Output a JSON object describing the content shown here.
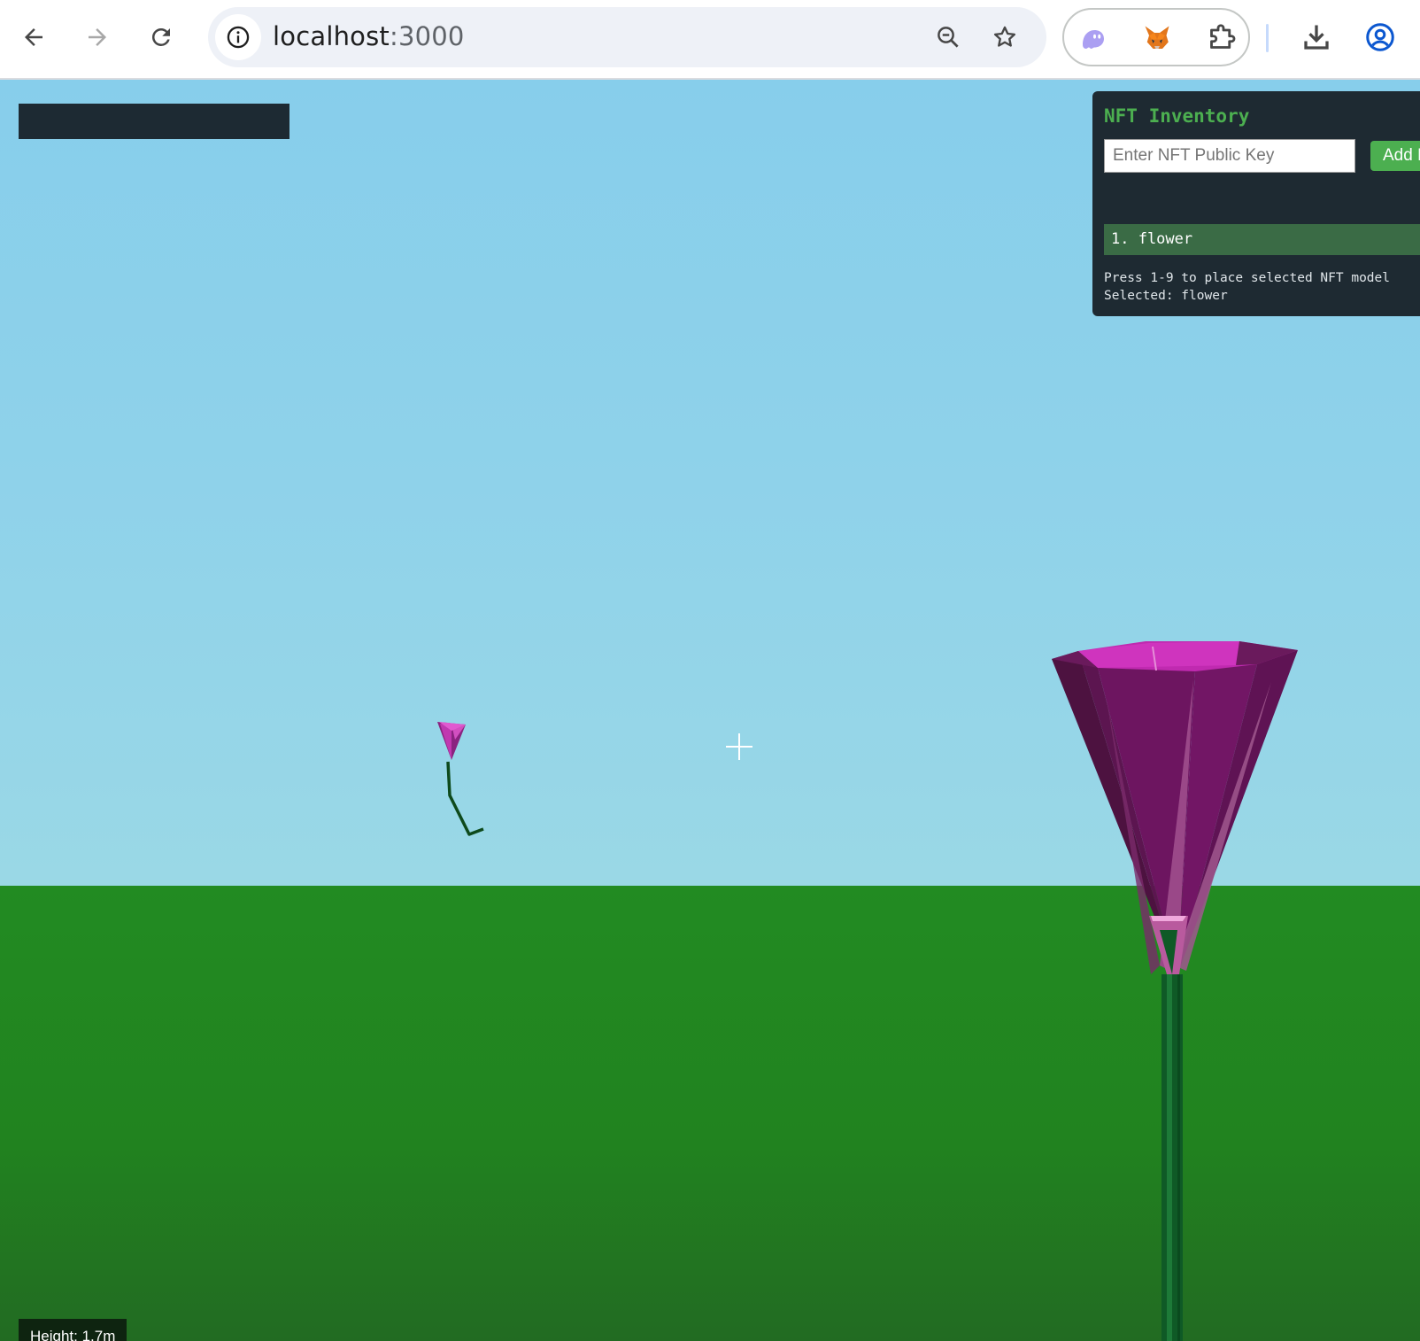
{
  "browser": {
    "url_host": "localhost",
    "url_port": ":3000",
    "icons": {
      "back": "arrow-left-icon",
      "forward": "arrow-right-icon",
      "reload": "reload-icon",
      "site_info": "info-icon",
      "zoom": "zoom-out-icon",
      "bookmark": "star-icon",
      "extension_1": "ghost-icon",
      "extension_2": "metamask-fox-icon",
      "extensions": "puzzle-icon",
      "downloads": "download-icon",
      "profile": "profile-icon"
    }
  },
  "nft_inventory": {
    "title": "NFT Inventory",
    "input_placeholder": "Enter NFT Public Key",
    "add_button_label": "Add N",
    "items": [
      {
        "label": "1. flower"
      }
    ],
    "help_line_1": "Press 1-9 to place selected NFT model",
    "help_line_2": "Selected: flower"
  },
  "hud": {
    "height_label": "Height: 1.7m"
  },
  "colors": {
    "sky": "#87ceeb",
    "ground": "#228b22",
    "panel_bg": "#1e2a32",
    "accent_green": "#4caf50",
    "flower_petal": "#8b1a7a",
    "flower_stem": "#0f5a26"
  }
}
